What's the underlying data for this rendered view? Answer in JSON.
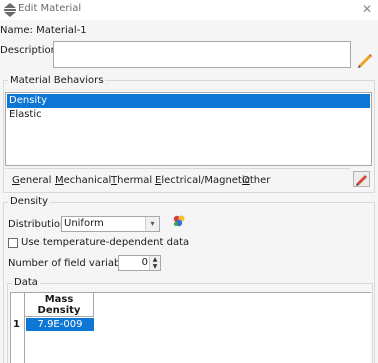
{
  "window": {
    "title": "Edit Material"
  },
  "name": {
    "label": "Name:",
    "value": "Material-1"
  },
  "description": {
    "label": "Description:",
    "value": ""
  },
  "material_behaviors": {
    "title": "Material Behaviors",
    "items": [
      {
        "label": "Density",
        "selected": true
      },
      {
        "label": "Elastic",
        "selected": false
      }
    ]
  },
  "menu": [
    {
      "label": "General",
      "mnemonic": "G"
    },
    {
      "label": "Mechanical",
      "mnemonic": "M"
    },
    {
      "label": "Thermal",
      "mnemonic": "T"
    },
    {
      "label": "Electrical/Magnetic",
      "mnemonic": "E"
    },
    {
      "label": "Other",
      "mnemonic": "O"
    }
  ],
  "density": {
    "title": "Density",
    "distribution_label": "Distribution:",
    "distribution_value": "Uniform",
    "temp_dependent_label": "Use temperature-dependent data",
    "temp_dependent_checked": false,
    "field_vars_label": "Number of field variables:",
    "field_vars_value": "0"
  },
  "data": {
    "title": "Data",
    "column_header": "Mass\nDensity",
    "rows": [
      {
        "index": "1",
        "mass_density": "7.9E-009"
      }
    ]
  },
  "colors": {
    "selection": "#0e76d4",
    "background": "#f5f5f5"
  }
}
